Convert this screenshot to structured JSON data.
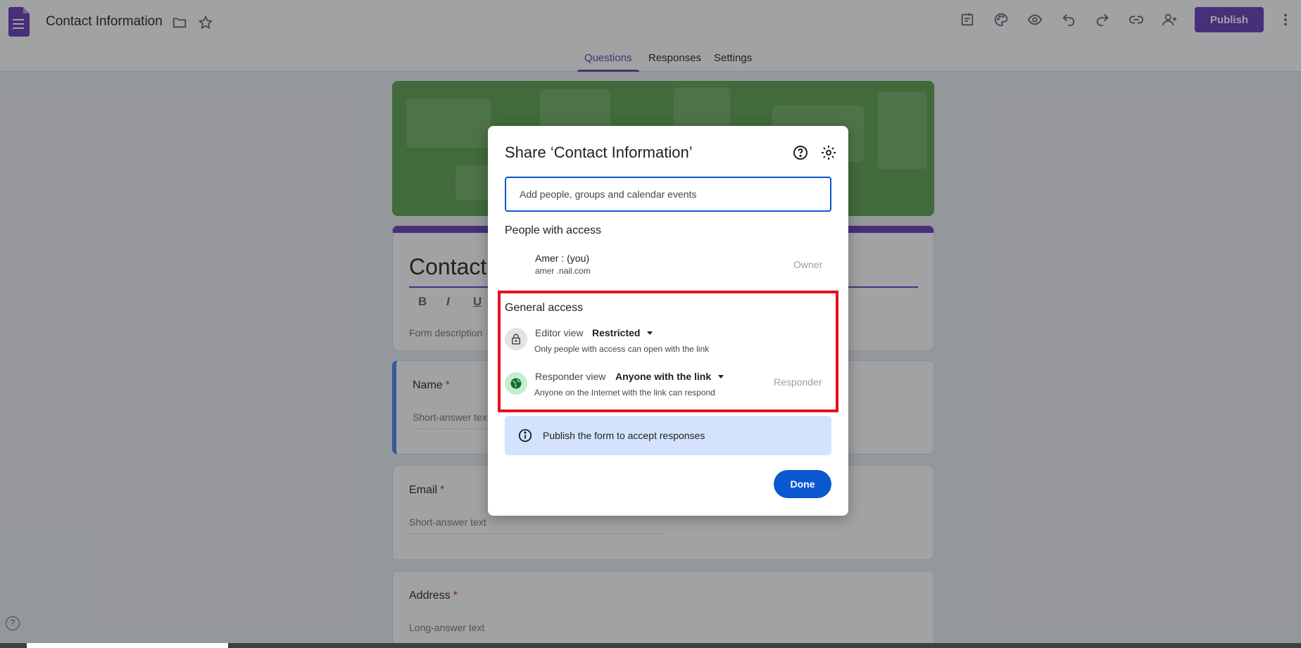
{
  "app": {
    "doc_title": "Contact Information",
    "publish_label": "Publish"
  },
  "tabs": [
    {
      "label": "Questions",
      "active": true
    },
    {
      "label": "Responses",
      "active": false
    },
    {
      "label": "Settings",
      "active": false
    }
  ],
  "form": {
    "title": "Contact",
    "format_bold": "B",
    "format_italic": "I",
    "format_underline": "U",
    "description_placeholder": "Form description",
    "questions": [
      {
        "label": "Name",
        "required_mark": "*",
        "answer_hint": "Short-answer text"
      },
      {
        "label": "Email",
        "required_mark": "*",
        "answer_hint": "Short-answer text"
      },
      {
        "label": "Address",
        "required_mark": "*",
        "answer_hint": "Long-answer text"
      }
    ]
  },
  "help_corner": "?",
  "dialog": {
    "title": "Share ‘Contact Information’",
    "add_placeholder": "Add people, groups and calendar events",
    "people_heading": "People with access",
    "person": {
      "name": "Amer            : (you)",
      "email": "amer            .nail.com",
      "role": "Owner"
    },
    "general_heading": "General access",
    "editor": {
      "role": "Editor view",
      "value": "Restricted",
      "desc": "Only people with access can open with the link"
    },
    "responder": {
      "role": "Responder view",
      "value": "Anyone with the link",
      "desc": "Anyone on the Internet with the link can respond",
      "badge": "Responder"
    },
    "info": "Publish the form to accept responses",
    "done_label": "Done"
  },
  "colors": {
    "brand": "#673ab7",
    "primary_blue": "#0b57d0",
    "highlight_red": "#e8101c",
    "info_bg": "#d3e3fd",
    "banner_green": "#5aa04a"
  },
  "icons": [
    "forms-logo-icon",
    "folder-icon",
    "star-icon",
    "add-ons-icon",
    "palette-icon",
    "preview-icon",
    "undo-icon",
    "redo-icon",
    "link-icon",
    "add-person-icon",
    "more-vert-icon",
    "help-icon",
    "gear-icon",
    "lock-icon",
    "globe-icon",
    "info-icon"
  ]
}
